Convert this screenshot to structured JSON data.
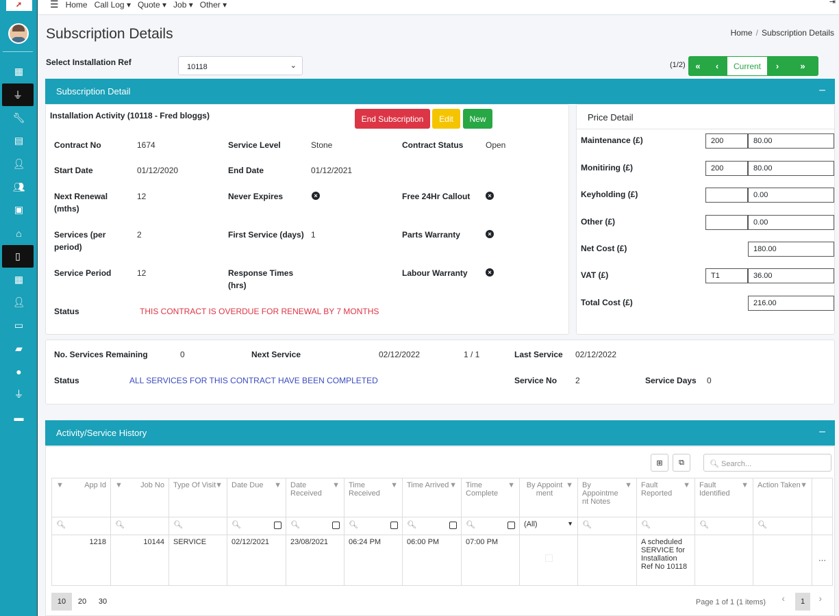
{
  "topnav": {
    "items": [
      "Home",
      "Call Log ▾",
      "Quote ▾",
      "Job ▾",
      "Other ▾"
    ]
  },
  "page": {
    "title": "Subscription Details"
  },
  "breadcrumb": {
    "home": "Home",
    "current": "Subscription Details"
  },
  "select": {
    "label": "Select Installation Ref",
    "value": "10118"
  },
  "pager": {
    "count": "(1/2)",
    "current": "Current"
  },
  "subscription": {
    "header": "Subscription Detail",
    "activity_title": "Installation Activity (10118 - Fred bloggs)",
    "buttons": {
      "end": "End Subscription",
      "edit": "Edit",
      "new": "New"
    },
    "fields": {
      "contract_no_label": "Contract No",
      "contract_no": "1674",
      "service_level_label": "Service Level",
      "service_level": "Stone",
      "contract_status_label": "Contract Status",
      "contract_status": "Open",
      "start_date_label": "Start Date",
      "start_date": "01/12/2020",
      "end_date_label": "End Date",
      "end_date": "01/12/2021",
      "next_renewal_label": "Next Renewal (mths)",
      "next_renewal": "12",
      "never_expires_label": "Never Expires",
      "free_callout_label": "Free 24Hr Callout",
      "services_label": "Services (per period)",
      "services": "2",
      "first_service_label": "First Service (days)",
      "first_service": "1",
      "parts_warranty_label": "Parts Warranty",
      "service_period_label": "Service Period",
      "service_period": "12",
      "response_times_label": "Response Times (hrs)",
      "labour_warranty_label": "Labour Warranty",
      "status_label": "Status",
      "status": "THIS CONTRACT IS OVERDUE FOR RENEWAL BY 7 MONTHS"
    }
  },
  "price": {
    "header": "Price Detail",
    "maintenance_label": "Maintenance (£)",
    "maintenance_qty": "200",
    "maintenance": "80.00",
    "monitoring_label": "Monitiring (£)",
    "monitoring_qty": "200",
    "monitoring": "80.00",
    "keyholding_label": "Keyholding (£)",
    "keyholding": "0.00",
    "other_label": "Other (£)",
    "other": "0.00",
    "net_label": "Net Cost (£)",
    "net": "180.00",
    "vat_label": "VAT (£)",
    "vat_code": "T1",
    "vat": "36.00",
    "total_label": "Total Cost (£)",
    "total": "216.00"
  },
  "services": {
    "remaining_label": "No. Services Remaining",
    "remaining": "0",
    "next_label": "Next Service",
    "next": "02/12/2022",
    "ratio": "1 / 1",
    "last_label": "Last Service",
    "last": "02/12/2022",
    "status_label": "Status",
    "status": "ALL SERVICES FOR THIS CONTRACT HAVE BEEN COMPLETED",
    "service_no_label": "Service No",
    "service_no": "2",
    "service_days_label": "Service Days",
    "service_days": "0"
  },
  "history": {
    "header": "Activity/Service History",
    "search_placeholder": "Search...",
    "columns": [
      "App Id",
      "Job No",
      "Type Of Visit",
      "Date Due",
      "Date Received",
      "Time Received",
      "Time Arrived",
      "Time Complete",
      "By Appoint ment",
      "By Appointme nt Notes",
      "Fault Reported",
      "Fault Identified",
      "Action Taken"
    ],
    "filter_all": "(All)",
    "row": {
      "app_id": "1218",
      "job_no": "10144",
      "type": "SERVICE",
      "date_due": "02/12/2021",
      "date_received": "23/08/2021",
      "time_received": "06:24 PM",
      "time_arrived": "06:00 PM",
      "time_complete": "07:00 PM",
      "fault_reported": "A scheduled SERVICE for Installation Ref No 10118"
    },
    "page_sizes": [
      "10",
      "20",
      "30"
    ],
    "page_info": "Page 1 of 1 (1 items)",
    "page": "1"
  }
}
